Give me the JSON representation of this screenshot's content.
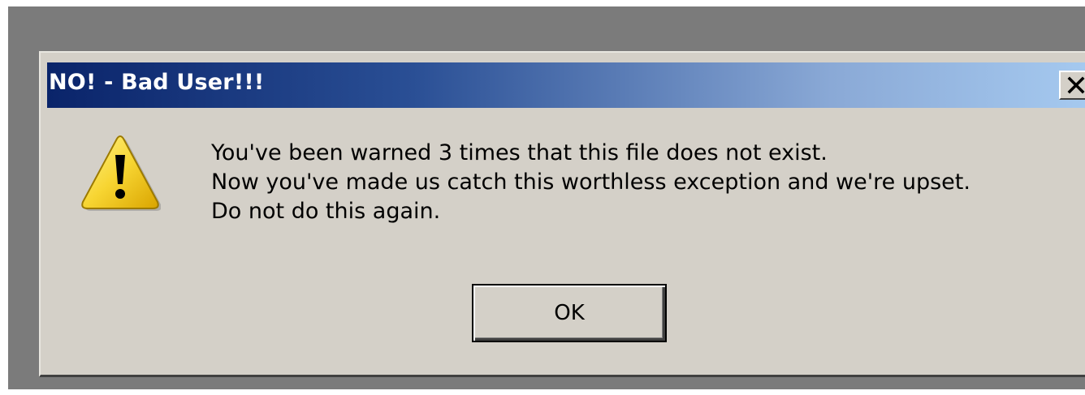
{
  "dialog": {
    "title": "NO! - Bad User!!!",
    "icon": "warning-icon",
    "message_lines": [
      "You've been warned 3 times that this file does not exist.",
      "Now you've made us catch this worthless exception and we're upset.",
      "Do not do this again."
    ],
    "ok_label": "OK"
  },
  "colors": {
    "titlebar_start": "#0a246a",
    "titlebar_end": "#a6caf0",
    "dialog_face": "#d4d0c8",
    "desktop": "#7b7b7b",
    "warning_fill": "#f7d532"
  }
}
